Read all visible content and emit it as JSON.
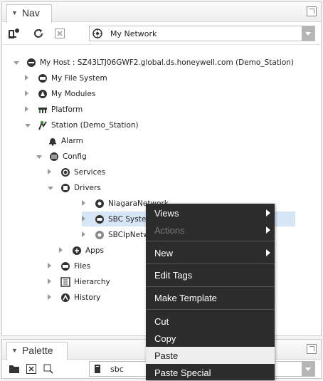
{
  "nav": {
    "tab_label": "Nav",
    "ord_value": "My Network",
    "tree": [
      {
        "label": "My Host : SZ43LTJ06GWF2.global.ds.honeywell.com (Demo_Station)",
        "icon": "host-icon",
        "state": "open"
      },
      {
        "label": "My File System",
        "icon": "file-system-icon",
        "state": "closed"
      },
      {
        "label": "My Modules",
        "icon": "modules-icon",
        "state": "closed"
      },
      {
        "label": "Platform",
        "icon": "platform-icon",
        "state": "closed"
      },
      {
        "label": "Station (Demo_Station)",
        "icon": "station-icon",
        "state": "open"
      },
      {
        "label": "Alarm",
        "icon": "bell-icon",
        "state": "none"
      },
      {
        "label": "Config",
        "icon": "database-icon",
        "state": "open"
      },
      {
        "label": "Services",
        "icon": "services-icon",
        "state": "closed"
      },
      {
        "label": "Drivers",
        "icon": "drivers-icon",
        "state": "open"
      },
      {
        "label": "NiagaraNetwork",
        "icon": "network-icon",
        "state": "closed"
      },
      {
        "label": "SBC System",
        "icon": "device-icon",
        "state": "closed"
      },
      {
        "label": "SBCIpNetwork",
        "icon": "network-icon",
        "state": "closed"
      },
      {
        "label": "Apps",
        "icon": "apps-icon",
        "state": "closed"
      },
      {
        "label": "Files",
        "icon": "files-icon",
        "state": "closed"
      },
      {
        "label": "Hierarchy",
        "icon": "hierarchy-icon",
        "state": "closed"
      },
      {
        "label": "History",
        "icon": "history-icon",
        "state": "closed"
      }
    ]
  },
  "palette": {
    "tab_label": "Palette",
    "search_value": "sbc"
  },
  "context_menu": {
    "items": [
      {
        "label": "Views",
        "submenu": true,
        "disabled": false
      },
      {
        "label": "Actions",
        "submenu": true,
        "disabled": true
      },
      {
        "label": "New",
        "submenu": true,
        "disabled": false
      },
      {
        "label": "Edit Tags",
        "submenu": false,
        "disabled": false
      },
      {
        "label": "Make Template",
        "submenu": false,
        "disabled": false
      },
      {
        "label": "Cut",
        "submenu": false,
        "disabled": false
      },
      {
        "label": "Copy",
        "submenu": false,
        "disabled": false
      },
      {
        "label": "Paste",
        "submenu": false,
        "disabled": false
      },
      {
        "label": "Paste Special",
        "submenu": false,
        "disabled": false
      }
    ]
  },
  "colors": {
    "selection": "#d7e6f7",
    "menu_bg": "#2c2c2c",
    "menu_hover": "#ededed"
  }
}
